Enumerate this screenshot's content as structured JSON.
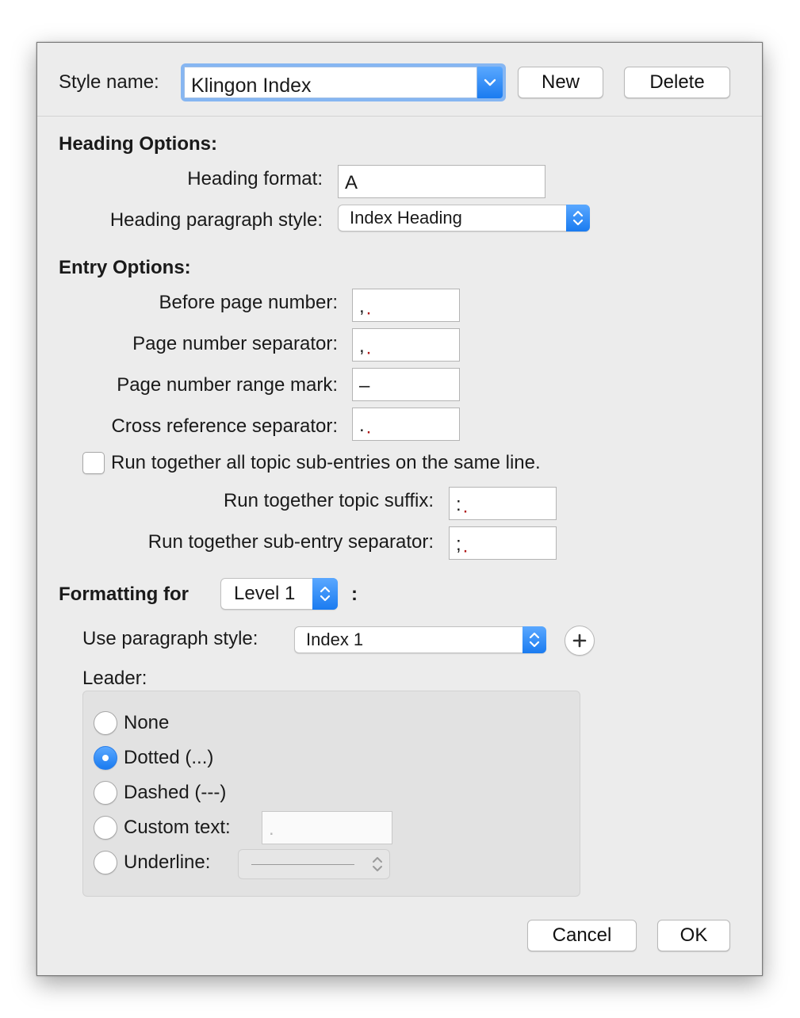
{
  "style_name": {
    "label": "Style name:",
    "value": "Klingon Index"
  },
  "buttons": {
    "new": "New",
    "delete": "Delete",
    "cancel": "Cancel",
    "ok": "OK"
  },
  "heading_options": {
    "title": "Heading Options:",
    "format_label": "Heading format:",
    "format_value": "A",
    "paragraph_style_label": "Heading paragraph style:",
    "paragraph_style_value": "Index Heading"
  },
  "entry_options": {
    "title": "Entry Options:",
    "before_page_label": "Before page number:",
    "before_page_value": ",",
    "page_sep_label": "Page number separator:",
    "page_sep_value": ",",
    "range_mark_label": "Page number range mark:",
    "range_mark_value": "–",
    "cross_ref_label": "Cross reference separator:",
    "cross_ref_value": ".",
    "run_together_label": "Run together all topic sub-entries on the same line.",
    "run_together_checked": false,
    "topic_suffix_label": "Run together topic suffix:",
    "topic_suffix_value": ":",
    "subentry_sep_label": "Run together sub-entry separator:",
    "subentry_sep_value": ";"
  },
  "formatting": {
    "title": "Formatting for",
    "level_value": "Level 1",
    "colon": ":",
    "paragraph_style_label": "Use paragraph style:",
    "paragraph_style_value": "Index 1",
    "leader_label": "Leader:",
    "leader_options": {
      "none": "None",
      "dotted": "Dotted (...)",
      "dashed": "Dashed (---)",
      "custom": "Custom text:",
      "underline": "Underline:"
    },
    "leader_selected": "Dotted (...)",
    "custom_text_value": "."
  },
  "colors": {
    "accent": "#1a7bf0",
    "dialog_bg": "#ececec",
    "invisible_char": "#b01818"
  }
}
